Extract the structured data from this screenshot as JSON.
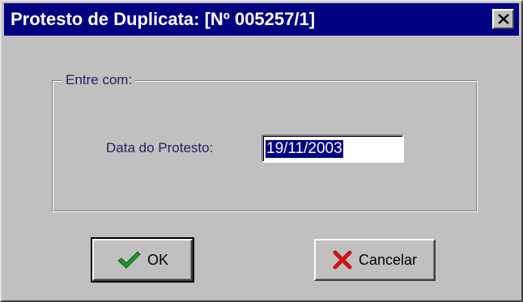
{
  "window": {
    "title": "Protesto de Duplicata: [Nº 005257/1]"
  },
  "group": {
    "legend": "Entre com:"
  },
  "form": {
    "date_label": "Data do Protesto:",
    "date_value": "19/11/2003"
  },
  "buttons": {
    "ok_label": "OK",
    "ok_icon": "checkmark-icon",
    "cancel_label": "Cancelar",
    "cancel_icon": "red-x-icon"
  },
  "colors": {
    "titlebar": "#000080",
    "face": "#c0c0c0",
    "label_text": "#202060",
    "ok_check": "#1e9a2a",
    "cancel_x": "#c81414"
  }
}
